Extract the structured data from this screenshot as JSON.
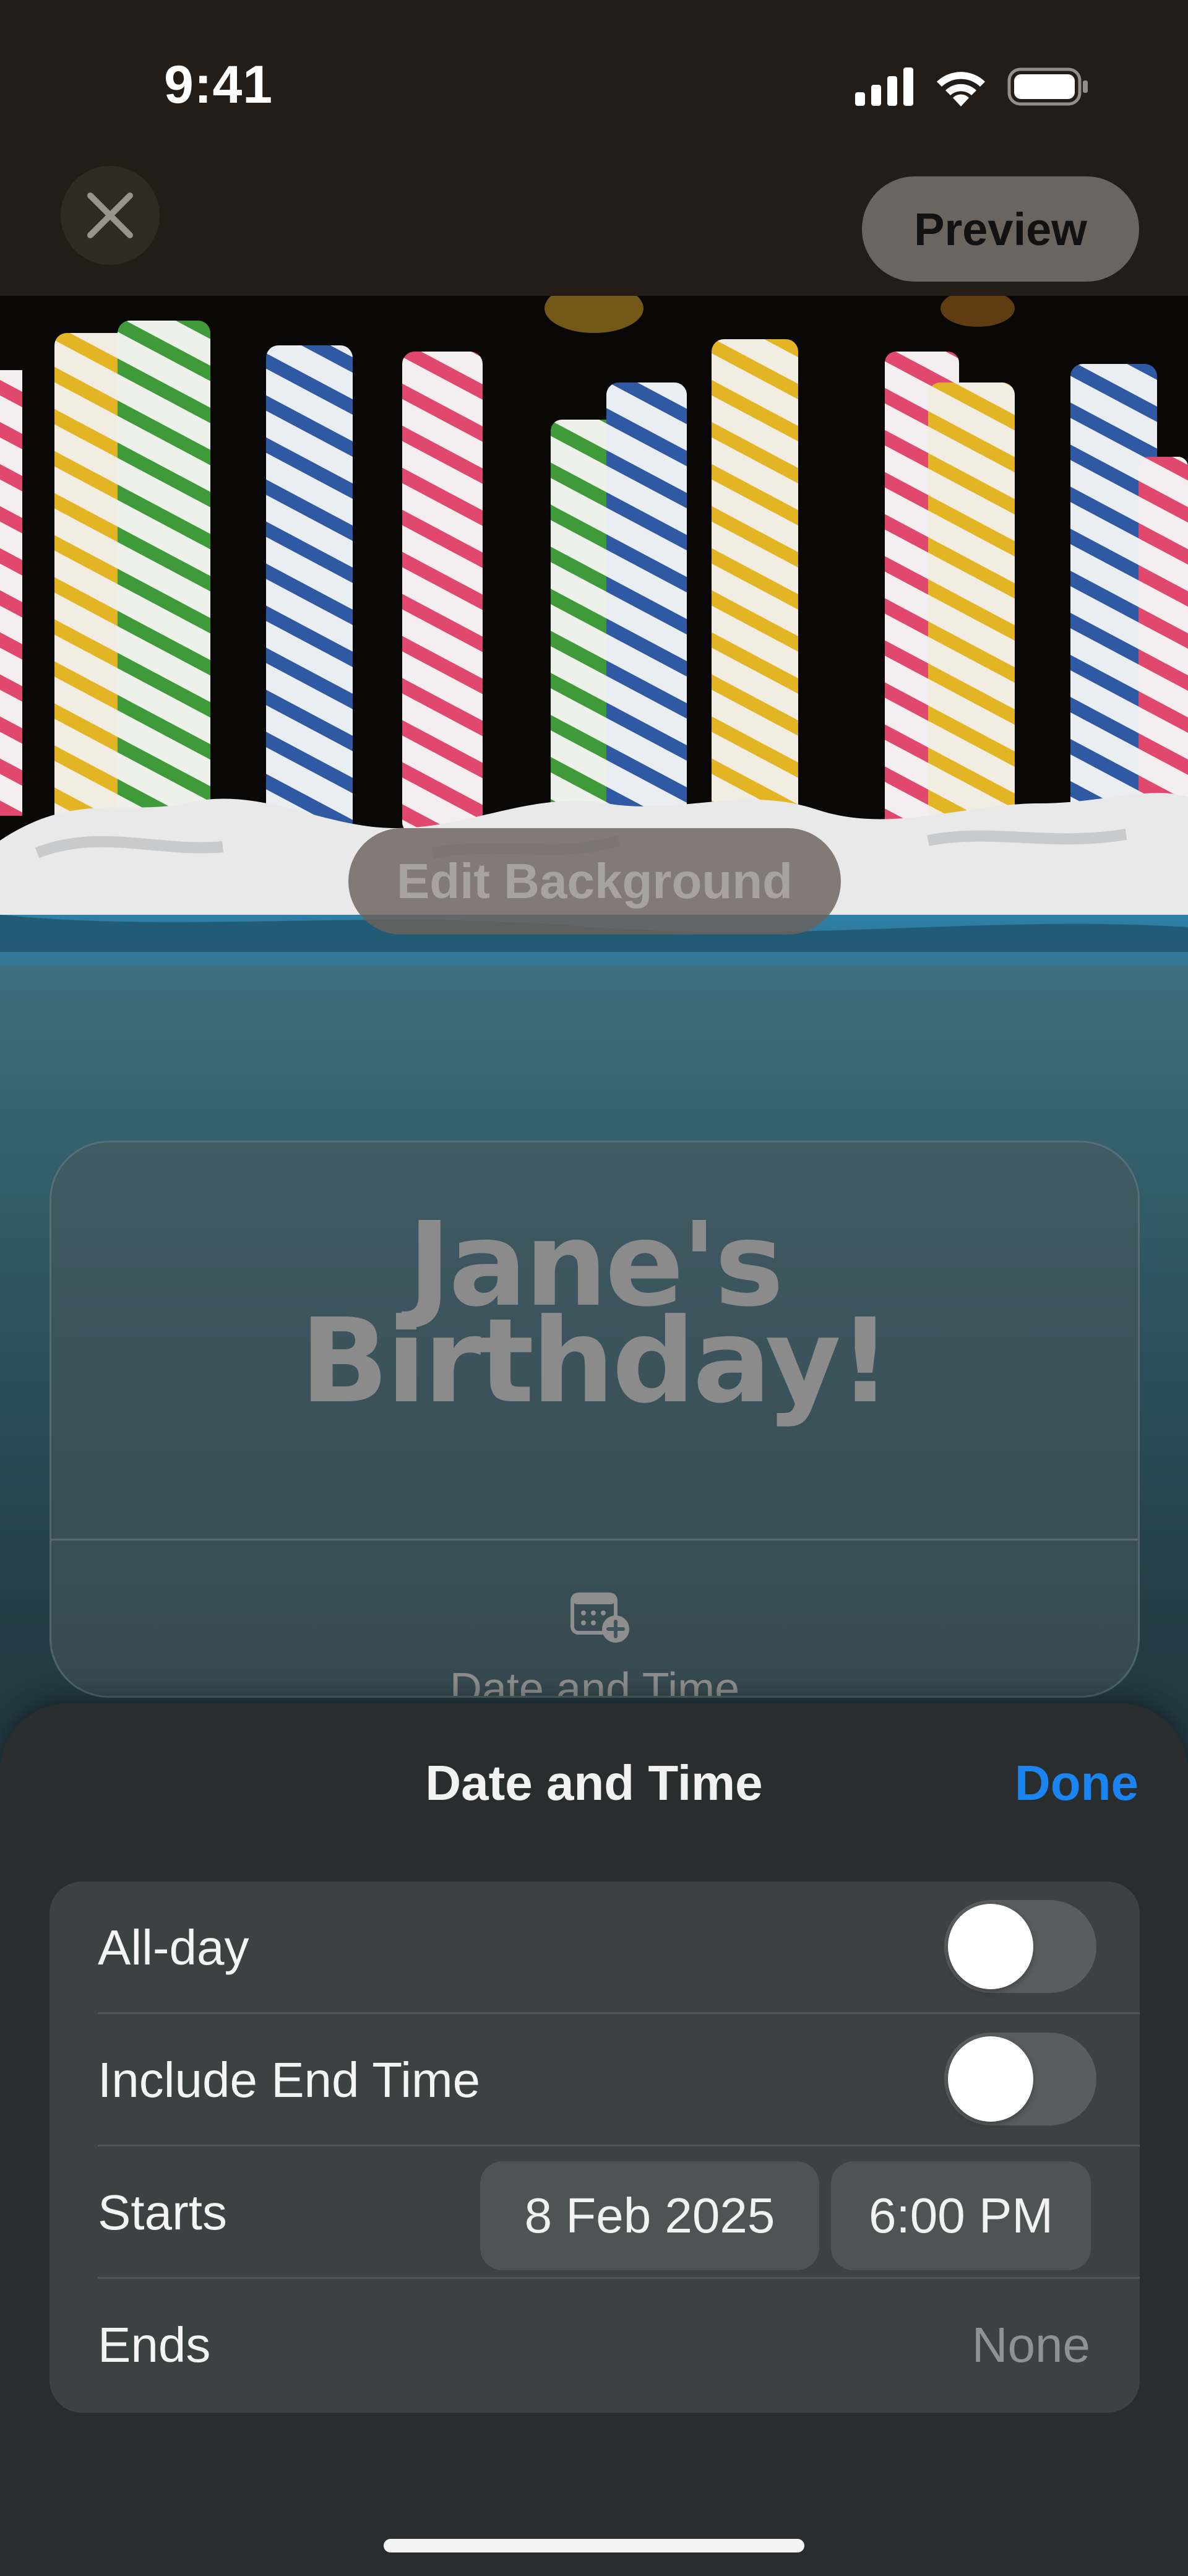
{
  "status_bar": {
    "time": "9:41",
    "icons": [
      "signal-icon",
      "wifi-icon",
      "battery-icon"
    ]
  },
  "toolbar": {
    "close_icon": "close-icon",
    "preview_label": "Preview"
  },
  "background": {
    "edit_label": "Edit Background"
  },
  "invite_card": {
    "title_line1": "Jane's",
    "title_line2": "Birthday!",
    "date_label": "Date and Time",
    "date_icon": "calendar-add-icon"
  },
  "sheet": {
    "title": "Date and Time",
    "done_label": "Done",
    "rows": [
      {
        "label": "All-day",
        "toggle": false
      },
      {
        "label": "Include End Time",
        "toggle": false
      },
      {
        "label": "Starts",
        "date": "8 Feb 2025",
        "time": "6:00 PM"
      },
      {
        "label": "Ends",
        "value": "None"
      }
    ]
  },
  "colors": {
    "accent": "#1a84f2",
    "sheet_background": "#2a2d2e",
    "group_background": "#3e4142"
  }
}
